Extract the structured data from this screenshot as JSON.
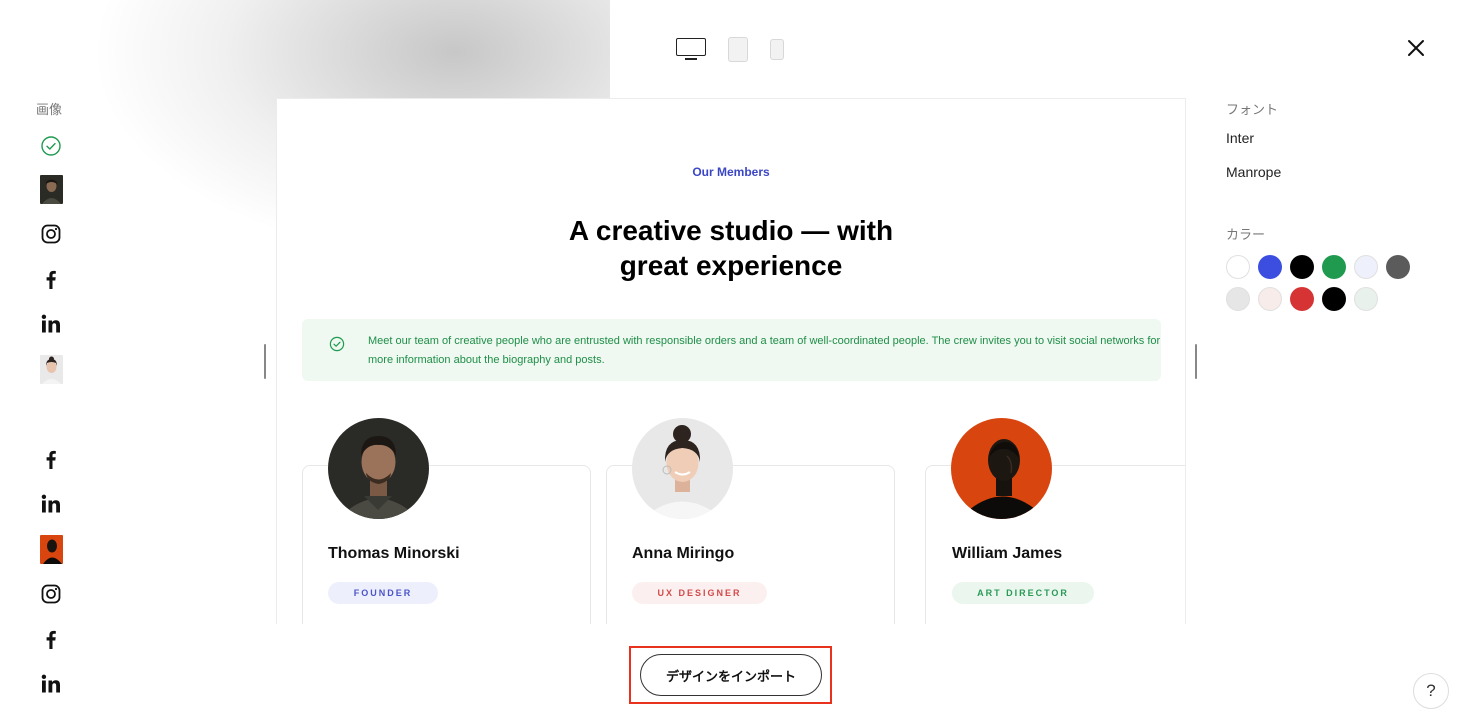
{
  "toolbar": {
    "devices": [
      "desktop",
      "tablet",
      "mobile"
    ],
    "close_icon": "close-icon"
  },
  "left_panel": {
    "title": "画像",
    "items": [
      {
        "type": "icon",
        "icon": "check-circle-icon"
      },
      {
        "type": "image",
        "description_key": "thomas-photo"
      },
      {
        "type": "icon",
        "icon": "instagram-icon"
      },
      {
        "type": "icon",
        "icon": "facebook-icon"
      },
      {
        "type": "icon",
        "icon": "linkedin-icon"
      },
      {
        "type": "image",
        "description_key": "anna-photo"
      },
      {
        "type": "icon",
        "icon": "facebook-icon"
      },
      {
        "type": "icon",
        "icon": "linkedin-icon"
      },
      {
        "type": "image",
        "description_key": "william-photo"
      },
      {
        "type": "icon",
        "icon": "instagram-icon"
      },
      {
        "type": "icon",
        "icon": "facebook-icon"
      },
      {
        "type": "icon",
        "icon": "linkedin-icon"
      }
    ]
  },
  "preview": {
    "eyebrow": "Our Members",
    "headline_line1": "A creative studio — with",
    "headline_line2": "great experience",
    "notice_text": "Meet our team of creative people who are entrusted with responsible orders and a team of well-coordinated people. The crew invites you to visit social networks for more information about the biography and posts.",
    "members": [
      {
        "name": "Thomas Minorski",
        "role": "FOUNDER",
        "role_bg": "#eeeffc",
        "role_color": "#4b54c8"
      },
      {
        "name": "Anna Miringo",
        "role": "UX DESIGNER",
        "role_bg": "#fcefef",
        "role_color": "#d24b4b"
      },
      {
        "name": "William James",
        "role": "ART DIRECTOR",
        "role_bg": "#eaf6ee",
        "role_color": "#2b9a57"
      }
    ]
  },
  "right_panel": {
    "font_title": "フォント",
    "fonts": [
      "Inter",
      "Manrope"
    ],
    "color_title": "カラー",
    "colors_row1": [
      "#ffffff",
      "#3b4ee0",
      "#000000",
      "#1f9a4f",
      "#eef0fb",
      "#5b5b5b"
    ],
    "colors_row2": [
      "#e6e6e6",
      "#f7ecea",
      "#d63434",
      "#000000",
      "#e9f1ec"
    ]
  },
  "import_button": "デザインをインポート",
  "help_button": "?"
}
